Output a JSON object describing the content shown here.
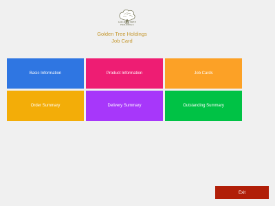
{
  "branding": {
    "logo_text_line1": "GOLDEN TREE",
    "logo_text_line2": "HOLDINGS",
    "company_name": "Golden Tree Holdings",
    "page_subtitle": "Job Card"
  },
  "tiles": [
    {
      "label": "Basic Information",
      "color": "#2f76e2"
    },
    {
      "label": "Product Information",
      "color": "#ee1d73"
    },
    {
      "label": "Job Cards",
      "color": "#fca126"
    },
    {
      "label": "Order Summary",
      "color": "#f3ad08"
    },
    {
      "label": "Delivery Summary",
      "color": "#a737fa"
    },
    {
      "label": "Outstanding Summary",
      "color": "#00c245"
    }
  ],
  "footer": {
    "exit_label": "Exit",
    "exit_color": "#b11f08"
  },
  "icons": {
    "logo": "tree-logo-icon"
  }
}
